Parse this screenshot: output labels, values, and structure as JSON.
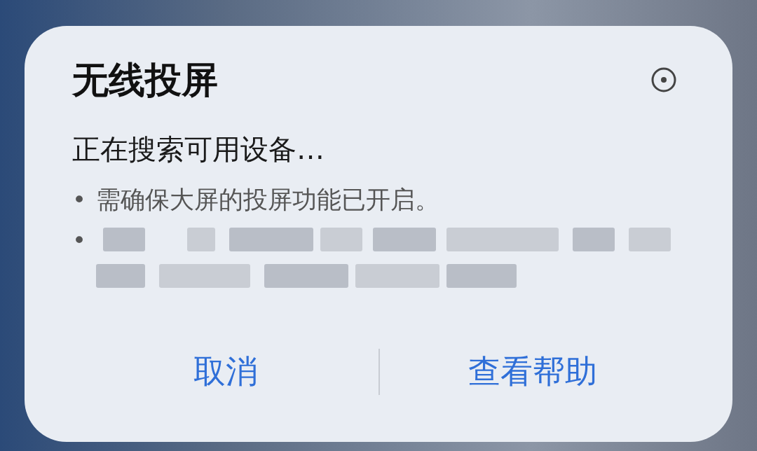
{
  "dialog": {
    "title": "无线投屏",
    "status": "正在搜索可用设备…",
    "bullets": [
      {
        "kind": "text",
        "marker": "•",
        "text": "需确保大屏的投屏功能已开启。"
      },
      {
        "kind": "redacted",
        "marker": "•"
      }
    ],
    "buttons": [
      "取消",
      "查看帮助"
    ]
  }
}
